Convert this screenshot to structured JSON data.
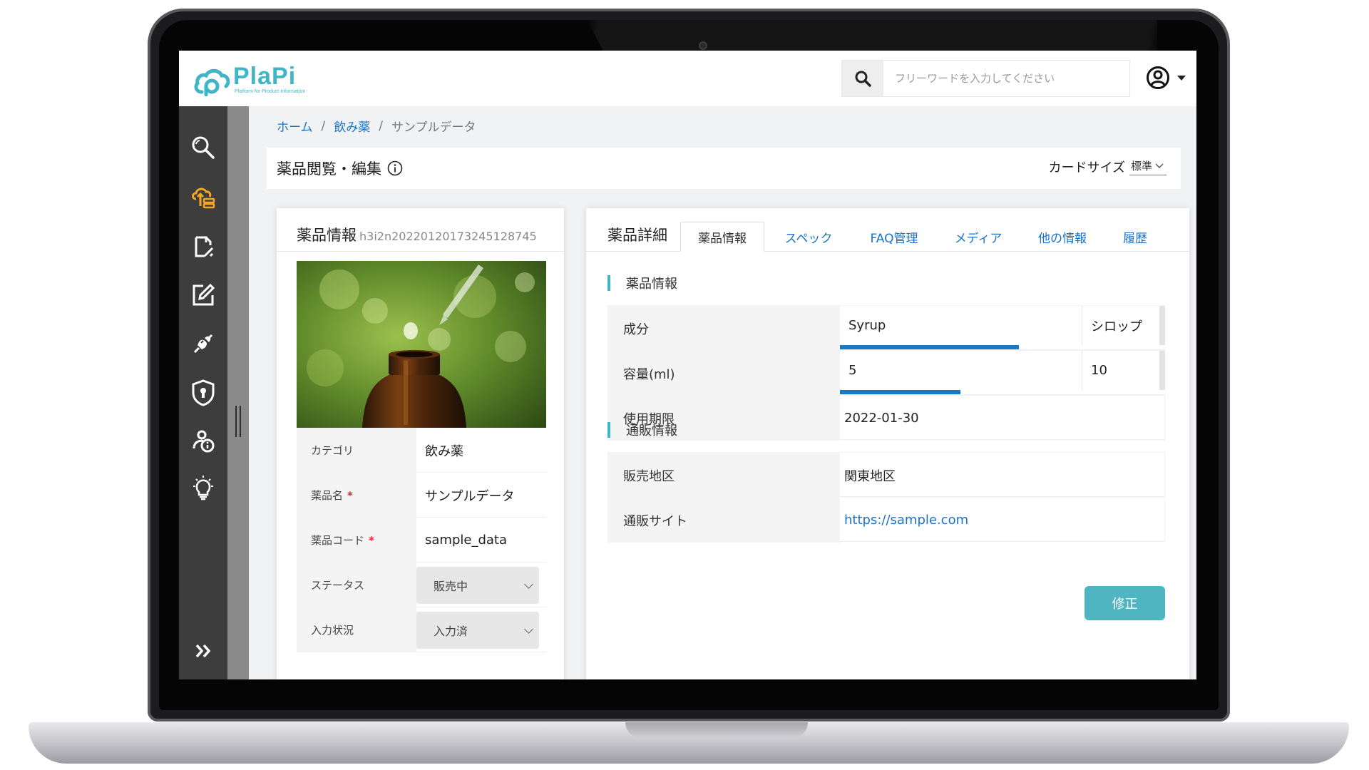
{
  "app": {
    "logo_text": "PlaPi",
    "logo_subtitle": "Platform for Product Information",
    "accent_color": "#3fb6c8",
    "link_color": "#1a73c9"
  },
  "header": {
    "search_placeholder": "フリーワードを入力してください",
    "search_icon": "search-icon",
    "user_icon": "user-circle-icon"
  },
  "sidebar": {
    "items": [
      {
        "icon": "search-icon",
        "active": false
      },
      {
        "icon": "cloud-upload-icon",
        "active": true
      },
      {
        "icon": "file-edit-icon",
        "active": false
      },
      {
        "icon": "edit-icon",
        "active": false
      },
      {
        "icon": "plug-icon",
        "active": false
      },
      {
        "icon": "shield-lock-icon",
        "active": false
      },
      {
        "icon": "users-info-icon",
        "active": false
      },
      {
        "icon": "lightbulb-icon",
        "active": false
      }
    ],
    "expand_icon": "double-chevron-right-icon"
  },
  "breadcrumb": {
    "home": "ホーム",
    "separator": "/",
    "category": "飲み薬",
    "current": "サンプルデータ"
  },
  "page": {
    "title": "薬品閲覧・編集",
    "card_size_label": "カードサイズ",
    "card_size_value": "標準"
  },
  "left_card": {
    "title": "薬品情報",
    "record_id": "h3i2n20220120173245128745",
    "fields": [
      {
        "label": "カテゴリ",
        "required": false,
        "value": "飲み薬"
      },
      {
        "label": "薬品名",
        "required": true,
        "value": "サンプルデータ"
      },
      {
        "label": "薬品コード",
        "required": true,
        "value": "sample_data"
      },
      {
        "label": "ステータス",
        "required": false,
        "value": "販売中"
      },
      {
        "label": "入力状況",
        "required": false,
        "value": "入力済"
      }
    ],
    "required_mark": "*"
  },
  "right_card": {
    "title": "薬品詳細",
    "tabs": [
      "薬品情報",
      "スペック",
      "FAQ管理",
      "メディア",
      "他の情報",
      "履歴"
    ],
    "active_tab": 0,
    "section1": {
      "title": "薬品情報",
      "rows": [
        {
          "label": "成分",
          "value_a": "Syrup",
          "value_b": "シロップ",
          "progress": 0.55
        },
        {
          "label": "容量(ml)",
          "value_a": "5",
          "value_b": "10",
          "progress": 0.37
        },
        {
          "label": "使用期限",
          "value": "2022-01-30"
        }
      ]
    },
    "section2": {
      "title": "通販情報",
      "rows": [
        {
          "label": "販売地区",
          "value": "関東地区"
        },
        {
          "label": "通販サイト",
          "value": "https://sample.com"
        }
      ]
    },
    "edit_button": "修正"
  }
}
